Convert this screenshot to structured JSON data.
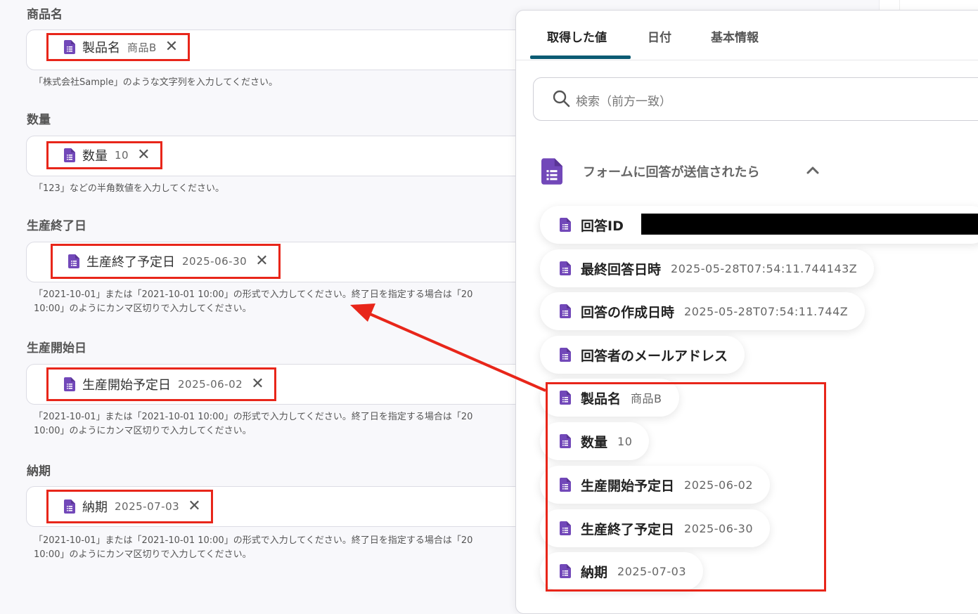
{
  "fields": [
    {
      "label": "商品名",
      "chip_name": "製品名",
      "chip_value": "商品B",
      "help": [
        "「株式会社Sample」のような文字列を入力してください。"
      ]
    },
    {
      "label": "数量",
      "chip_name": "数量",
      "chip_value": "10",
      "help": [
        "「123」などの半角数値を入力してください。"
      ]
    },
    {
      "label": "生産終了日",
      "chip_name": "生産終了予定日",
      "chip_value": "2025-06-30",
      "help": [
        "「2021-10-01」または「2021-10-01 10:00」の形式で入力してください。終了日を指定する場合は「20",
        "10:00」のようにカンマ区切りで入力してください。"
      ]
    },
    {
      "label": "生産開始日",
      "chip_name": "生産開始予定日",
      "chip_value": "2025-06-02",
      "help": [
        "「2021-10-01」または「2021-10-01 10:00」の形式で入力してください。終了日を指定する場合は「20",
        "10:00」のようにカンマ区切りで入力してください。"
      ]
    },
    {
      "label": "納期",
      "chip_name": "納期",
      "chip_value": "2025-07-03",
      "help": [
        "「2021-10-01」または「2021-10-01 10:00」の形式で入力してください。終了日を指定する場合は「20",
        "10:00」のようにカンマ区切りで入力してください。"
      ]
    }
  ],
  "chip_remove_symbol": "✕",
  "panel": {
    "tabs": [
      "取得した値",
      "日付",
      "基本情報"
    ],
    "active_tab": "取得した値",
    "search_placeholder": "検索（前方一致）",
    "group_title": "フォームに回答が送信されたら",
    "items": [
      {
        "name": "回答ID",
        "value": ""
      },
      {
        "name": "最終回答日時",
        "value": "2025-05-28T07:54:11.744143Z"
      },
      {
        "name": "回答の作成日時",
        "value": "2025-05-28T07:54:11.744Z"
      },
      {
        "name": "回答者のメールアドレス",
        "value": ""
      },
      {
        "name": "製品名",
        "value": "商品B"
      },
      {
        "name": "数量",
        "value": "10"
      },
      {
        "name": "生産開始予定日",
        "value": "2025-06-02"
      },
      {
        "name": "生産終了予定日",
        "value": "2025-06-30"
      },
      {
        "name": "納期",
        "value": "2025-07-03"
      }
    ]
  },
  "colors": {
    "form_icon": "#7248b9",
    "highlight": "#e8261a",
    "tab_accent": "#0b5b73"
  },
  "icons": [
    "form-doc-icon",
    "close-icon",
    "search-icon",
    "chevron-up-icon"
  ]
}
